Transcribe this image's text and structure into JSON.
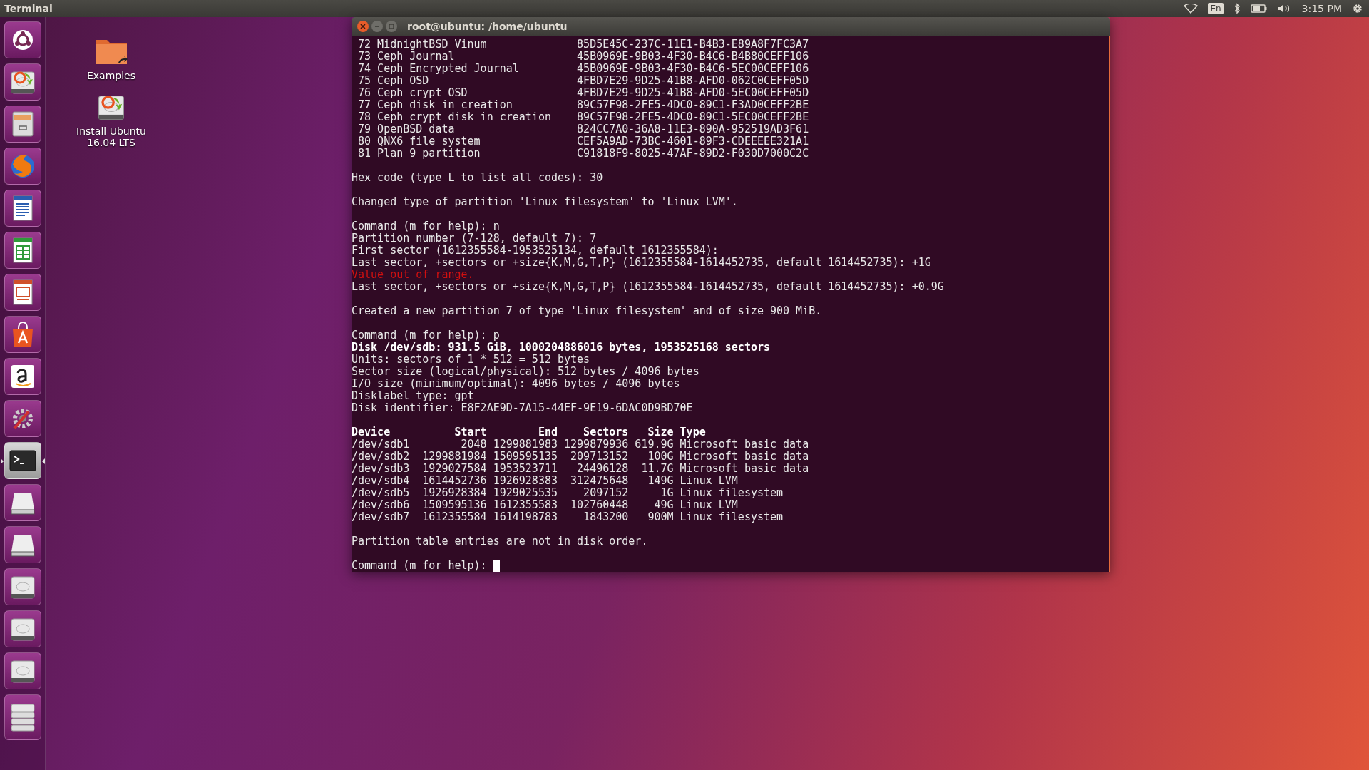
{
  "top_bar": {
    "app_title": "Terminal",
    "keyboard_layout": "En",
    "clock": "3:15 PM"
  },
  "launcher": {
    "items": [
      {
        "kind": "dash",
        "selected": false
      },
      {
        "kind": "installer",
        "selected": false
      },
      {
        "kind": "files",
        "selected": false
      },
      {
        "kind": "browser",
        "selected": false
      },
      {
        "kind": "writer",
        "selected": false
      },
      {
        "kind": "calc",
        "selected": false
      },
      {
        "kind": "impress",
        "selected": false
      },
      {
        "kind": "software",
        "selected": false
      },
      {
        "kind": "amazon",
        "selected": false
      },
      {
        "kind": "settings",
        "selected": false
      },
      {
        "kind": "terminal",
        "selected": true
      },
      {
        "kind": "drive",
        "selected": false
      },
      {
        "kind": "drive",
        "selected": false
      },
      {
        "kind": "disk",
        "selected": false
      },
      {
        "kind": "disk",
        "selected": false
      },
      {
        "kind": "disk",
        "selected": false
      },
      {
        "kind": "stack",
        "selected": false
      }
    ]
  },
  "desktop_icons": [
    {
      "kind": "folder",
      "label": "Examples"
    },
    {
      "kind": "installer",
      "label": "Install Ubuntu 16.04 LTS"
    }
  ],
  "terminal": {
    "title": "root@ubuntu: /home/ubuntu",
    "lines": [
      {
        "kind": "normal",
        "text": " 72 MidnightBSD Vinum              85D5E45C-237C-11E1-B4B3-E89A8F7FC3A7"
      },
      {
        "kind": "normal",
        "text": " 73 Ceph Journal                   45B0969E-9B03-4F30-B4C6-B4B80CEFF106"
      },
      {
        "kind": "normal",
        "text": " 74 Ceph Encrypted Journal         45B0969E-9B03-4F30-B4C6-5EC00CEFF106"
      },
      {
        "kind": "normal",
        "text": " 75 Ceph OSD                       4FBD7E29-9D25-41B8-AFD0-062C0CEFF05D"
      },
      {
        "kind": "normal",
        "text": " 76 Ceph crypt OSD                 4FBD7E29-9D25-41B8-AFD0-5EC00CEFF05D"
      },
      {
        "kind": "normal",
        "text": " 77 Ceph disk in creation          89C57F98-2FE5-4DC0-89C1-F3AD0CEFF2BE"
      },
      {
        "kind": "normal",
        "text": " 78 Ceph crypt disk in creation    89C57F98-2FE5-4DC0-89C1-5EC00CEFF2BE"
      },
      {
        "kind": "normal",
        "text": " 79 OpenBSD data                   824CC7A0-36A8-11E3-890A-952519AD3F61"
      },
      {
        "kind": "normal",
        "text": " 80 QNX6 file system               CEF5A9AD-73BC-4601-89F3-CDEEEEE321A1"
      },
      {
        "kind": "normal",
        "text": " 81 Plan 9 partition               C91818F9-8025-47AF-89D2-F030D7000C2C"
      },
      {
        "kind": "blank"
      },
      {
        "kind": "normal",
        "text": "Hex code (type L to list all codes): 30"
      },
      {
        "kind": "blank"
      },
      {
        "kind": "normal",
        "text": "Changed type of partition 'Linux filesystem' to 'Linux LVM'."
      },
      {
        "kind": "blank"
      },
      {
        "kind": "normal",
        "text": "Command (m for help): n"
      },
      {
        "kind": "normal",
        "text": "Partition number (7-128, default 7): 7"
      },
      {
        "kind": "normal",
        "text": "First sector (1612355584-1953525134, default 1612355584):"
      },
      {
        "kind": "normal",
        "text": "Last sector, +sectors or +size{K,M,G,T,P} (1612355584-1614452735, default 1614452735): +1G"
      },
      {
        "kind": "error",
        "text": "Value out of range."
      },
      {
        "kind": "normal",
        "text": "Last sector, +sectors or +size{K,M,G,T,P} (1612355584-1614452735, default 1614452735): +0.9G"
      },
      {
        "kind": "blank"
      },
      {
        "kind": "normal",
        "text": "Created a new partition 7 of type 'Linux filesystem' and of size 900 MiB."
      },
      {
        "kind": "blank"
      },
      {
        "kind": "normal",
        "text": "Command (m for help): p"
      },
      {
        "kind": "bold",
        "text": "Disk /dev/sdb: 931.5 GiB, 1000204886016 bytes, 1953525168 sectors"
      },
      {
        "kind": "normal",
        "text": "Units: sectors of 1 * 512 = 512 bytes"
      },
      {
        "kind": "normal",
        "text": "Sector size (logical/physical): 512 bytes / 4096 bytes"
      },
      {
        "kind": "normal",
        "text": "I/O size (minimum/optimal): 4096 bytes / 4096 bytes"
      },
      {
        "kind": "normal",
        "text": "Disklabel type: gpt"
      },
      {
        "kind": "normal",
        "text": "Disk identifier: E8F2AE9D-7A15-44EF-9E19-6DAC0D9BD70E"
      },
      {
        "kind": "blank"
      },
      {
        "kind": "bold",
        "text": "Device          Start        End    Sectors   Size Type"
      },
      {
        "kind": "normal",
        "text": "/dev/sdb1        2048 1299881983 1299879936 619.9G Microsoft basic data"
      },
      {
        "kind": "normal",
        "text": "/dev/sdb2  1299881984 1509595135  209713152   100G Microsoft basic data"
      },
      {
        "kind": "normal",
        "text": "/dev/sdb3  1929027584 1953523711   24496128  11.7G Microsoft basic data"
      },
      {
        "kind": "normal",
        "text": "/dev/sdb4  1614452736 1926928383  312475648   149G Linux LVM"
      },
      {
        "kind": "normal",
        "text": "/dev/sdb5  1926928384 1929025535    2097152     1G Linux filesystem"
      },
      {
        "kind": "normal",
        "text": "/dev/sdb6  1509595136 1612355583  102760448    49G Linux LVM"
      },
      {
        "kind": "normal",
        "text": "/dev/sdb7  1612355584 1614198783    1843200   900M Linux filesystem"
      },
      {
        "kind": "blank"
      },
      {
        "kind": "normal",
        "text": "Partition table entries are not in disk order."
      },
      {
        "kind": "blank"
      },
      {
        "kind": "prompt",
        "text": "Command (m for help): "
      }
    ]
  }
}
